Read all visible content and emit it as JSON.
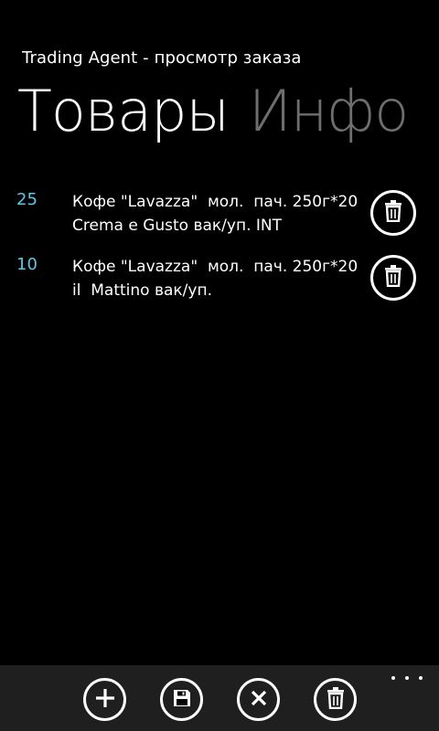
{
  "app": {
    "title": "Trading Agent - просмотр заказа"
  },
  "pivot": {
    "tabs": [
      {
        "label": "Товары",
        "active": true
      },
      {
        "label": "Инфо",
        "active": false
      }
    ]
  },
  "items": [
    {
      "quantity": "25",
      "name": "Кофе \"Lavazza\"  мол.  пач. 250г*20\nCrema e Gusto вак/уп. INT",
      "delete_icon": "trash-icon"
    },
    {
      "quantity": "10",
      "name": "Кофе \"Lavazza\"  мол.  пач. 250г*20\nil  Mattino вак/уп.",
      "delete_icon": "trash-icon"
    }
  ],
  "app_bar": {
    "buttons": [
      {
        "icon": "add-icon"
      },
      {
        "icon": "save-icon"
      },
      {
        "icon": "cancel-icon"
      },
      {
        "icon": "trash-icon"
      }
    ],
    "more_icon": "ellipsis-icon"
  },
  "colors": {
    "background": "#000000",
    "accent": "#5bc8e8",
    "inactive_tab": "#6e6e6e",
    "app_bar": "#1f1f1f"
  }
}
